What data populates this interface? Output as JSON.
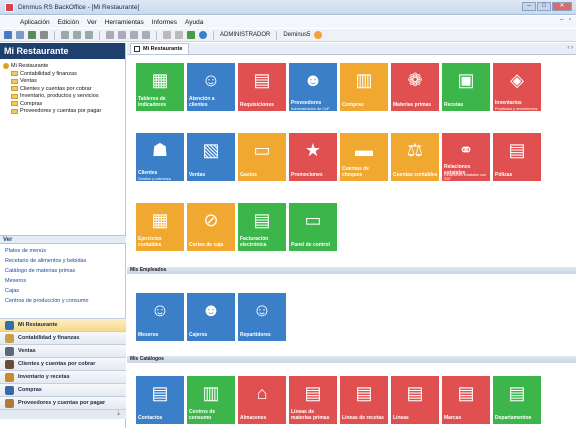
{
  "window": {
    "title": "Dimmus RS BackOffice - [Mi Restaurante]",
    "controls": [
      "–",
      "□",
      "✕"
    ]
  },
  "menubar": {
    "items": [
      "Aplicación",
      "Edición",
      "Ver",
      "Herramientas",
      "Informes",
      "Ayuda"
    ],
    "mdi_controls": "– ▫"
  },
  "toolbar": {
    "user": "ADMINISTRADOR",
    "company": "Deminus5"
  },
  "left": {
    "header": "Mi Restaurante",
    "tree_root": "Mi Restaurante",
    "tree_items": [
      "Contabilidad y finanzas",
      "Ventas",
      "Clientes y cuentas por cobrar",
      "Inventario, productos y servicios",
      "Compras",
      "Proveedores y cuentas por pagar"
    ],
    "ver_title": "Ver",
    "ver_links": [
      "Platos de menús",
      "Recetario de alimentos y bebidas",
      "Catálogo de materias primas",
      "Meseros",
      "Cajas",
      "Centros de producción y consumo"
    ],
    "nav": [
      {
        "label": "Mi Restaurante",
        "color": "#2f6fb6"
      },
      {
        "label": "Contabilidad y finanzas",
        "color": "#c9a04a"
      },
      {
        "label": "Ventas",
        "color": "#5a6a7a"
      },
      {
        "label": "Clientes y cuentas por cobrar",
        "color": "#6a4a3a"
      },
      {
        "label": "Inventario y recetas",
        "color": "#c98a2a"
      },
      {
        "label": "Compras",
        "color": "#3a6aa0"
      },
      {
        "label": "Proveedores y cuentas por pagar",
        "color": "#b07a3a"
      }
    ],
    "nav_footer": "⇣"
  },
  "content": {
    "tab_label": "Mi Restaurante",
    "tab_close": "‹ ›",
    "sections": [
      "Mis Empleados",
      "Mis Catálogos"
    ],
    "tiles_main": [
      {
        "label": "Tableros de indicadores",
        "sub": "",
        "color": "#3cb54a",
        "glyph": "▦"
      },
      {
        "label": "Atención a clientes",
        "sub": "",
        "color": "#3a7fc8",
        "glyph": "☺"
      },
      {
        "label": "Requisiciones",
        "sub": "",
        "color": "#e05050",
        "glyph": "▤"
      },
      {
        "label": "Proveedores",
        "sub": "Administración de CxP",
        "color": "#3a7fc8",
        "glyph": "☻"
      },
      {
        "label": "Compras",
        "sub": "",
        "color": "#f0a830",
        "glyph": "▥"
      },
      {
        "label": "Materias primas",
        "sub": "",
        "color": "#e05050",
        "glyph": "❁"
      },
      {
        "label": "Recetas",
        "sub": "",
        "color": "#3cb54a",
        "glyph": "▣"
      },
      {
        "label": "Inventarios",
        "sub": "Productos y movimientos",
        "color": "#e05050",
        "glyph": "◈"
      },
      {
        "label": "Clientes",
        "sub": "Gestión y cobranza",
        "color": "#3a7fc8",
        "glyph": "☗"
      },
      {
        "label": "Ventas",
        "sub": "",
        "color": "#3a7fc8",
        "glyph": "▧"
      },
      {
        "label": "Gastos",
        "sub": "",
        "color": "#f0a830",
        "glyph": "▭"
      },
      {
        "label": "Promociones",
        "sub": "",
        "color": "#e05050",
        "glyph": "★"
      },
      {
        "label": "Cuentas de cheques",
        "sub": "",
        "color": "#f0a830",
        "glyph": "▬"
      },
      {
        "label": "Cuentas contables",
        "sub": "",
        "color": "#f0a830",
        "glyph": "⚖"
      },
      {
        "label": "Relaciones estatales",
        "sub": "Relaciones estatales con SAT",
        "color": "#e05050",
        "glyph": "⚭"
      },
      {
        "label": "Pólizas",
        "sub": "",
        "color": "#e05050",
        "glyph": "▤"
      },
      {
        "label": "Ejercicios contables",
        "sub": "",
        "color": "#f0a830",
        "glyph": "▦"
      },
      {
        "label": "Cortes de caja",
        "sub": "",
        "color": "#f0a830",
        "glyph": "⊘"
      },
      {
        "label": "Facturación electrónica",
        "sub": "",
        "color": "#3cb54a",
        "glyph": "▤"
      },
      {
        "label": "Panel de control",
        "sub": "",
        "color": "#3cb54a",
        "glyph": "▭"
      }
    ],
    "tiles_employees": [
      {
        "label": "Meseros",
        "sub": "",
        "color": "#3a7fc8",
        "glyph": "☺"
      },
      {
        "label": "Cajeros",
        "sub": "",
        "color": "#3a7fc8",
        "glyph": "☻"
      },
      {
        "label": "Repartidores",
        "sub": "",
        "color": "#3a7fc8",
        "glyph": "☺"
      }
    ],
    "tiles_catalogs": [
      {
        "label": "Contactos",
        "sub": "",
        "color": "#3a7fc8",
        "glyph": "▤"
      },
      {
        "label": "Centros de consumo",
        "sub": "",
        "color": "#3cb54a",
        "glyph": "▥"
      },
      {
        "label": "Almacenes",
        "sub": "",
        "color": "#e05050",
        "glyph": "⌂"
      },
      {
        "label": "Líneas de materias primas",
        "sub": "",
        "color": "#e05050",
        "glyph": "▤"
      },
      {
        "label": "Líneas de recetas",
        "sub": "",
        "color": "#e05050",
        "glyph": "▤"
      },
      {
        "label": "Líneas",
        "sub": "",
        "color": "#e05050",
        "glyph": "▤"
      },
      {
        "label": "Marcas",
        "sub": "",
        "color": "#e05050",
        "glyph": "▤"
      },
      {
        "label": "Departamentos",
        "sub": "",
        "color": "#3cb54a",
        "glyph": "▤"
      }
    ]
  }
}
